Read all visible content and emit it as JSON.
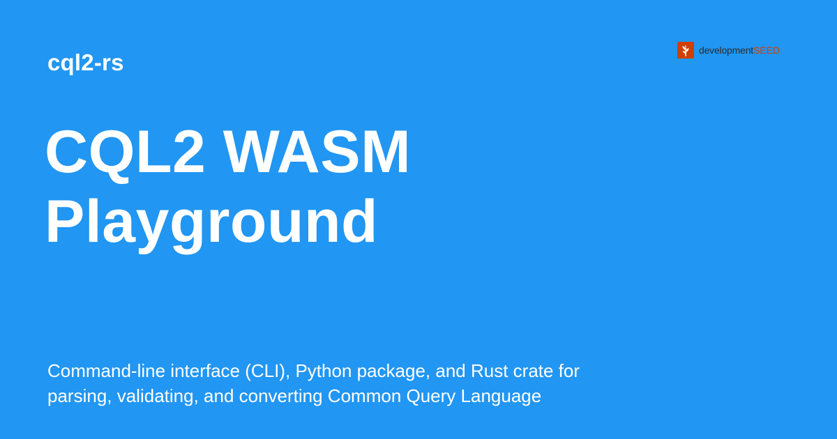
{
  "project": {
    "name": "cql2-rs"
  },
  "title": {
    "lines": [
      "CQL2 WASM",
      "Playground"
    ]
  },
  "description": {
    "lines": [
      "Command-line interface (CLI), Python package, and Rust crate for",
      "parsing, validating, and converting Common Query Language"
    ]
  },
  "logo": {
    "icon": "seed-sprout-icon",
    "text_primary": "development",
    "text_accent": "SEED"
  },
  "colors": {
    "background": "#2196f3",
    "text": "#ffffff",
    "logo_accent": "#cf3f02",
    "logo_text": "#2b2b2b"
  }
}
